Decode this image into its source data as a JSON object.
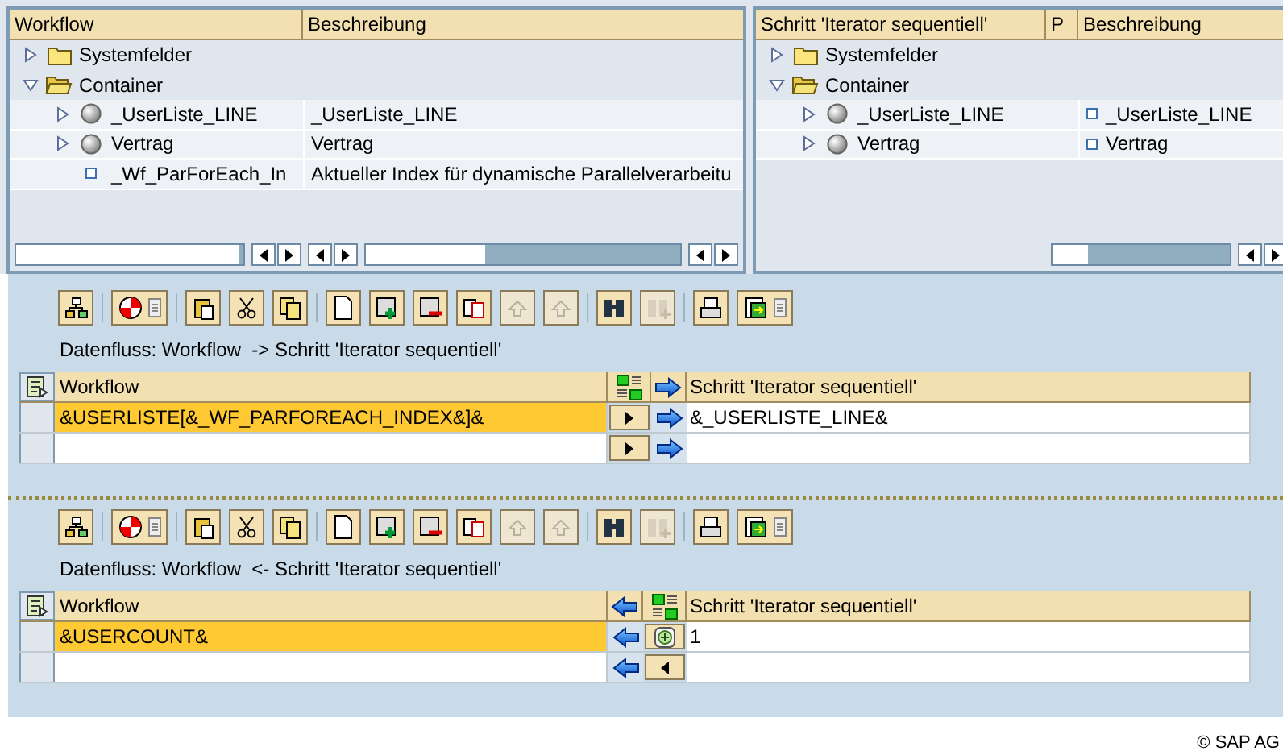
{
  "trees": [
    {
      "columns": [
        "Workflow",
        "Beschreibung"
      ],
      "nodes": [
        {
          "kind": "folder",
          "label": "Systemfelder",
          "expanded": false
        },
        {
          "kind": "folder",
          "label": "Container",
          "expanded": true,
          "children": [
            {
              "kind": "object",
              "label": "_UserListe_LINE",
              "description": "_UserListe_LINE",
              "expanded": false
            },
            {
              "kind": "object",
              "label": "Vertrag",
              "description": "Vertrag",
              "expanded": false
            },
            {
              "kind": "element",
              "label": "_Wf_ParForEach_In",
              "description": "Aktueller Index für dynamische Parallelverarbeitu"
            }
          ]
        }
      ]
    },
    {
      "columns": [
        "Schritt 'Iterator sequentiell'",
        "P",
        "Beschreibung"
      ],
      "nodes": [
        {
          "kind": "folder",
          "label": "Systemfelder",
          "expanded": false
        },
        {
          "kind": "folder",
          "label": "Container",
          "expanded": true,
          "children": [
            {
              "kind": "object",
              "label": "_UserListe_LINE",
              "description": "_UserListe_LINE",
              "expanded": false
            },
            {
              "kind": "object",
              "label": "Vertrag",
              "description": "Vertrag",
              "expanded": false
            }
          ]
        }
      ]
    }
  ],
  "flows": [
    {
      "kind": "forward",
      "toolbar": [
        {
          "disabled": false
        },
        {
          "disabled": false
        },
        {
          "disabled": false
        },
        {
          "disabled": false
        },
        {
          "disabled": false
        },
        {
          "disabled": false
        },
        {
          "disabled": false
        },
        {
          "disabled": false
        },
        {
          "disabled": false
        },
        {
          "disabled": true
        },
        {
          "disabled": true
        },
        {
          "disabled": false
        },
        {
          "disabled": true
        },
        {
          "disabled": false
        },
        {
          "disabled": false
        }
      ],
      "caption": "Datenfluss: Workflow  -> Schritt 'Iterator sequentiell'",
      "columns": [
        "Workflow",
        "Schritt 'Iterator sequentiell'"
      ],
      "rows": [
        {
          "workflow": "&USERLISTE[&_WF_PARFOREACH_INDEX&]&",
          "step": "&_USERLISTE_LINE&",
          "kind": "binding",
          "selected": true
        },
        {
          "kind": "binding",
          "selected": false
        }
      ]
    },
    {
      "kind": "backward",
      "toolbar": [
        {
          "disabled": false
        },
        {
          "disabled": false
        },
        {
          "disabled": false
        },
        {
          "disabled": false
        },
        {
          "disabled": false
        },
        {
          "disabled": false
        },
        {
          "disabled": false
        },
        {
          "disabled": false
        },
        {
          "disabled": false
        },
        {
          "disabled": true
        },
        {
          "disabled": true
        },
        {
          "disabled": false
        },
        {
          "disabled": true
        },
        {
          "disabled": false
        },
        {
          "disabled": false
        }
      ],
      "caption": "Datenfluss: Workflow  <- Schritt 'Iterator sequentiell'",
      "columns": [
        "Workflow",
        "Schritt 'Iterator sequentiell'"
      ],
      "rows": [
        {
          "workflow": "&USERCOUNT&",
          "step": "1",
          "kind": "constant",
          "selected": true
        },
        {
          "kind": "binding",
          "selected": false
        }
      ]
    }
  ],
  "copyright": "© SAP AG"
}
